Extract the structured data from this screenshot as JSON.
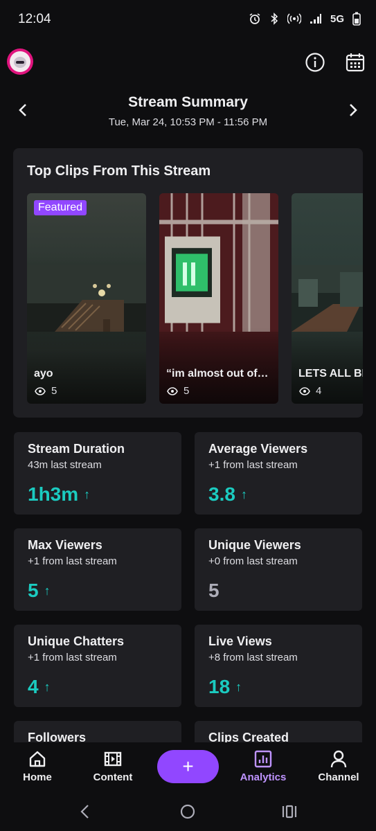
{
  "status": {
    "time": "12:04",
    "network": "5G"
  },
  "header": {
    "title": "Stream Summary",
    "date_range": "Tue, Mar 24, 10:53 PM - 11:56 PM"
  },
  "clips": {
    "title": "Top Clips From This Stream",
    "items": [
      {
        "badge": "Featured",
        "name": "ayo",
        "views": "5"
      },
      {
        "name": "“im almost out of…",
        "views": "5"
      },
      {
        "name": "LETS ALL BE",
        "views": "4"
      }
    ]
  },
  "stats": [
    {
      "label": "Stream Duration",
      "sub": "43m last stream",
      "value": "1h3m",
      "trend": "↑"
    },
    {
      "label": "Average Viewers",
      "sub": "+1 from last stream",
      "value": "3.8",
      "trend": "↑"
    },
    {
      "label": "Max Viewers",
      "sub": "+1 from last stream",
      "value": "5",
      "trend": "↑"
    },
    {
      "label": "Unique Viewers",
      "sub": "+0 from last stream",
      "value": "5",
      "trend": ""
    },
    {
      "label": "Unique Chatters",
      "sub": "+1 from last stream",
      "value": "4",
      "trend": "↑"
    },
    {
      "label": "Live Views",
      "sub": "+8 from last stream",
      "value": "18",
      "trend": "↑"
    },
    {
      "label": "Followers"
    },
    {
      "label": "Clips Created"
    }
  ],
  "nav": {
    "home": "Home",
    "content": "Content",
    "create": "+",
    "analytics": "Analytics",
    "channel": "Channel"
  },
  "colors": {
    "accent": "#9147ff",
    "positive": "#1bcbc0",
    "active_tab": "#bf94ff"
  }
}
